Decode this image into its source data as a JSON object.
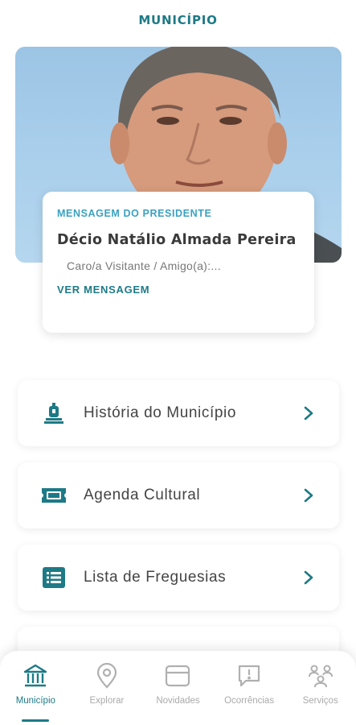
{
  "header": {
    "title": "MUNICÍPIO"
  },
  "president_message": {
    "section_label": "MENSAGEM DO PRESIDENTE",
    "name": "Décio Natálio Almada Pereira",
    "preview": "Caro/a Visitante / Amigo(a):...",
    "link_label": "VER MENSAGEM"
  },
  "menu": [
    {
      "label": "História do Município",
      "icon": "monument-icon"
    },
    {
      "label": "Agenda Cultural",
      "icon": "ticket-icon"
    },
    {
      "label": "Lista de Freguesias",
      "icon": "list-icon"
    }
  ],
  "bottom_nav": [
    {
      "label": "Município",
      "icon": "bank-icon",
      "active": true
    },
    {
      "label": "Explorar",
      "icon": "location-pin-icon",
      "active": false
    },
    {
      "label": "Novidades",
      "icon": "news-icon",
      "active": false
    },
    {
      "label": "Ocorrências",
      "icon": "report-icon",
      "active": false
    },
    {
      "label": "Serviços",
      "icon": "services-icon",
      "active": false
    }
  ],
  "colors": {
    "accent": "#1d7a86",
    "label_blue": "#3aa1c2",
    "inactive": "#aaaaaa"
  }
}
